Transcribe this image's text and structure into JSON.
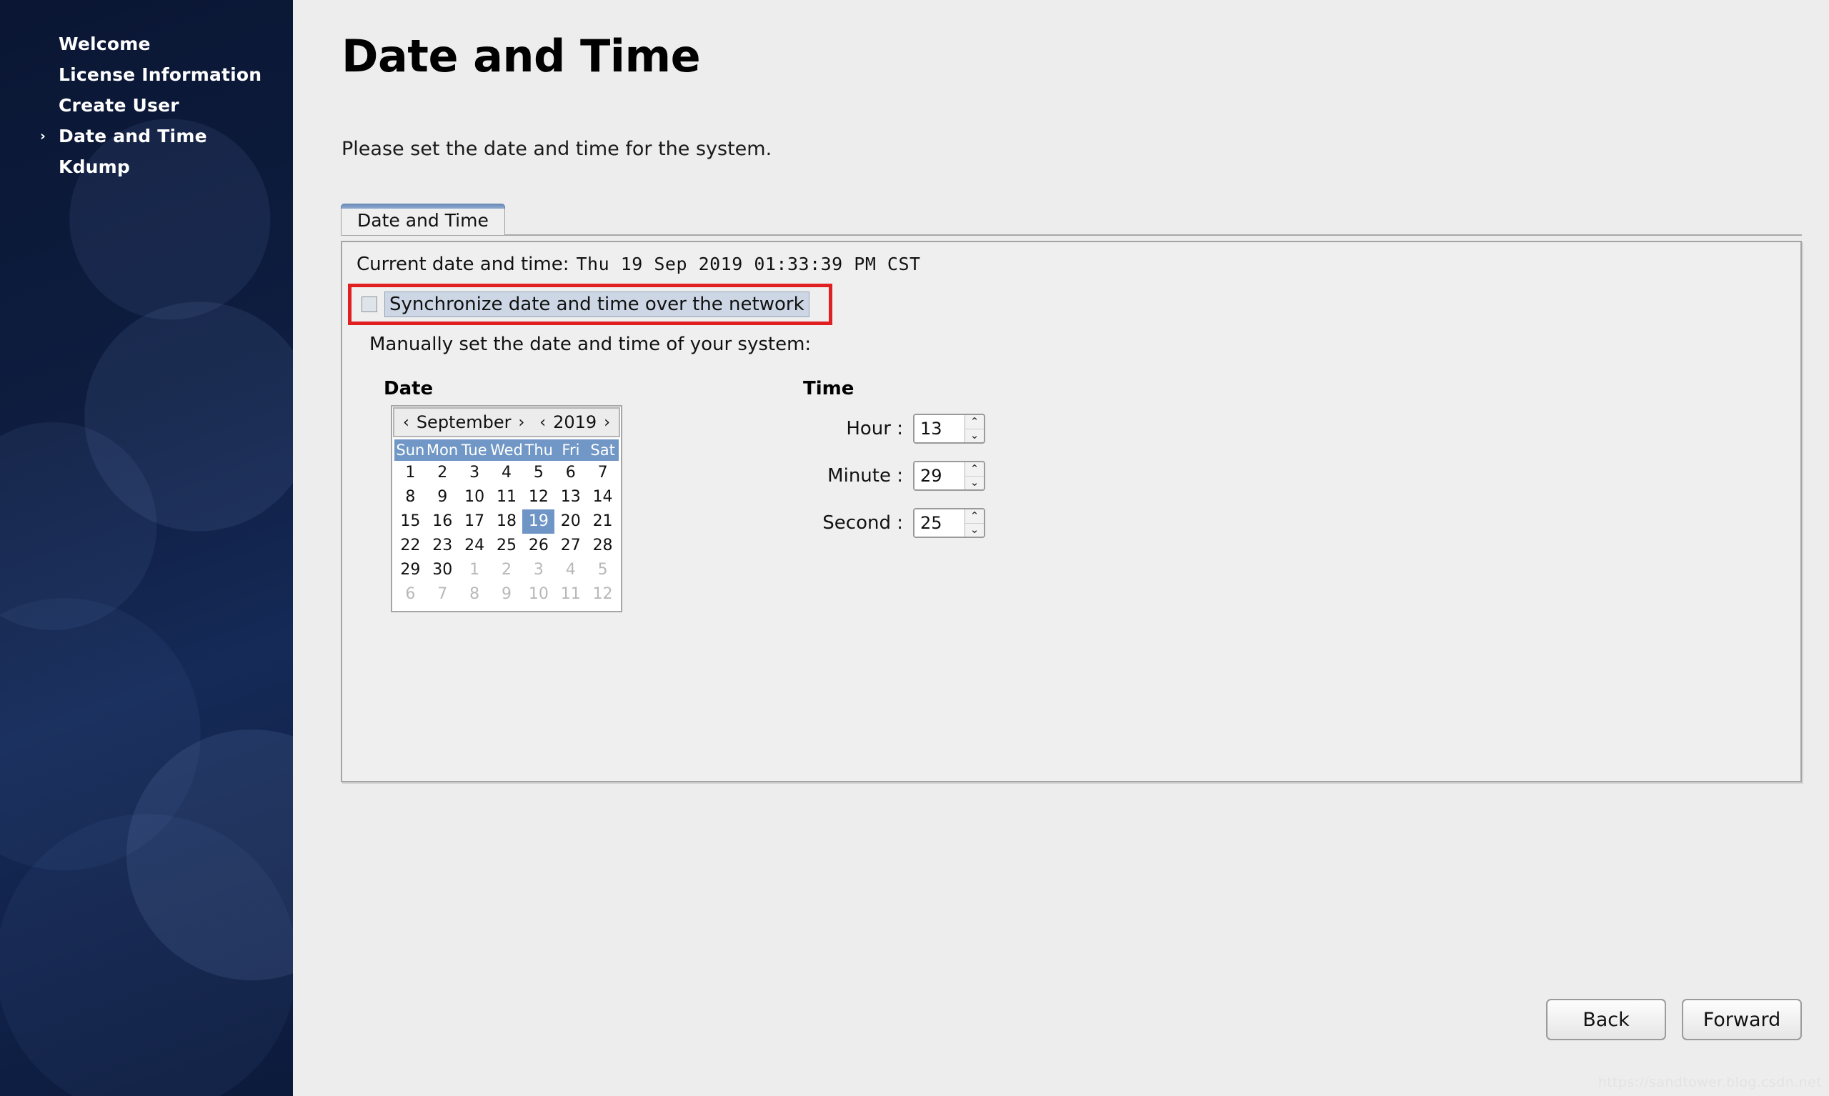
{
  "sidebar": {
    "items": [
      {
        "label": "Welcome",
        "selected": false,
        "arrow": ""
      },
      {
        "label": "License Information",
        "selected": false,
        "arrow": ""
      },
      {
        "label": "Create User",
        "selected": false,
        "arrow": ""
      },
      {
        "label": "Date and Time",
        "selected": true,
        "arrow": "›"
      },
      {
        "label": "Kdump",
        "selected": false,
        "arrow": ""
      }
    ]
  },
  "page": {
    "title": "Date and Time",
    "subtitle": "Please set the date and time for the system."
  },
  "tabs": [
    {
      "label": "Date and Time",
      "active": true
    }
  ],
  "panel": {
    "current_label": "Current date and time:",
    "current_value": "Thu 19 Sep 2019 01:33:39 PM CST",
    "sync_label": "Synchronize date and time over the network",
    "sync_checked": false,
    "manual_text": "Manually set the date and time of your system:",
    "highlight_color": "#e02020"
  },
  "date_section": {
    "heading": "Date",
    "month": "September",
    "year": "2019",
    "prev_arrow": "‹",
    "next_arrow": "›",
    "weekdays": [
      "Sun",
      "Mon",
      "Tue",
      "Wed",
      "Thu",
      "Fri",
      "Sat"
    ],
    "selected_day": 19,
    "weeks": [
      [
        {
          "d": "1",
          "m": false
        },
        {
          "d": "2",
          "m": false
        },
        {
          "d": "3",
          "m": false
        },
        {
          "d": "4",
          "m": false
        },
        {
          "d": "5",
          "m": false
        },
        {
          "d": "6",
          "m": false
        },
        {
          "d": "7",
          "m": false
        }
      ],
      [
        {
          "d": "8",
          "m": false
        },
        {
          "d": "9",
          "m": false
        },
        {
          "d": "10",
          "m": false
        },
        {
          "d": "11",
          "m": false
        },
        {
          "d": "12",
          "m": false
        },
        {
          "d": "13",
          "m": false
        },
        {
          "d": "14",
          "m": false
        }
      ],
      [
        {
          "d": "15",
          "m": false
        },
        {
          "d": "16",
          "m": false
        },
        {
          "d": "17",
          "m": false
        },
        {
          "d": "18",
          "m": false
        },
        {
          "d": "19",
          "m": false,
          "sel": true
        },
        {
          "d": "20",
          "m": false
        },
        {
          "d": "21",
          "m": false
        }
      ],
      [
        {
          "d": "22",
          "m": false
        },
        {
          "d": "23",
          "m": false
        },
        {
          "d": "24",
          "m": false
        },
        {
          "d": "25",
          "m": false
        },
        {
          "d": "26",
          "m": false
        },
        {
          "d": "27",
          "m": false
        },
        {
          "d": "28",
          "m": false
        }
      ],
      [
        {
          "d": "29",
          "m": false
        },
        {
          "d": "30",
          "m": false
        },
        {
          "d": "1",
          "m": true
        },
        {
          "d": "2",
          "m": true
        },
        {
          "d": "3",
          "m": true
        },
        {
          "d": "4",
          "m": true
        },
        {
          "d": "5",
          "m": true
        }
      ],
      [
        {
          "d": "6",
          "m": true
        },
        {
          "d": "7",
          "m": true
        },
        {
          "d": "8",
          "m": true
        },
        {
          "d": "9",
          "m": true
        },
        {
          "d": "10",
          "m": true
        },
        {
          "d": "11",
          "m": true
        },
        {
          "d": "12",
          "m": true
        }
      ]
    ]
  },
  "time_section": {
    "heading": "Time",
    "up_arrow": "⌃",
    "down_arrow": "⌄",
    "fields": [
      {
        "label": "Hour :",
        "value": "13",
        "name": "hour"
      },
      {
        "label": "Minute :",
        "value": "29",
        "name": "minute"
      },
      {
        "label": "Second :",
        "value": "25",
        "name": "second"
      }
    ]
  },
  "footer": {
    "back_label": "Back",
    "forward_label": "Forward"
  },
  "watermark": "https://sandtower.blog.csdn.net"
}
